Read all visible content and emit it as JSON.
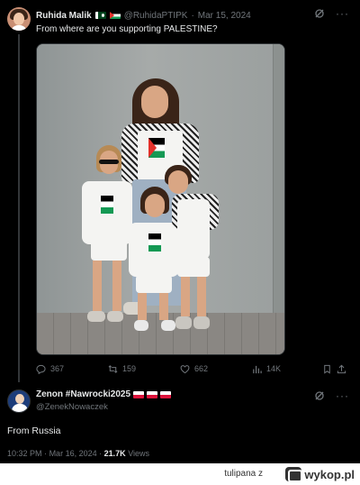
{
  "tweet": {
    "author_name": "Ruhida Malik",
    "author_handle": "@RuhidaPTIPK",
    "date": "Mar 15, 2024",
    "separator": "·",
    "text": "From where are you supporting PALESTINE?",
    "icons": {
      "author_flags": [
        "pakistan-flag-icon",
        "palestine-flag-icon"
      ]
    },
    "stats": {
      "replies": "367",
      "reposts": "159",
      "likes": "662",
      "views": "14K"
    }
  },
  "reply": {
    "author_name": "Zenon #Nawrocki2025",
    "author_handle": "@ZenekNowaczek",
    "text": "From Russia",
    "time": "10:32 PM",
    "date": "Mar 16, 2024",
    "separator": "·",
    "views_count": "21.7K",
    "views_label": "Views",
    "icons": {
      "author_flags": [
        "poland-flag-icon",
        "poland-flag-icon",
        "poland-flag-icon"
      ]
    }
  },
  "footer": {
    "username": "tulipana",
    "connector": "z",
    "site_name": "wykop.pl"
  },
  "colors": {
    "background": "#000000",
    "text": "#e7e9ea",
    "muted": "#71767b",
    "divider": "#2f3336",
    "footer_bg": "#ffffff"
  }
}
